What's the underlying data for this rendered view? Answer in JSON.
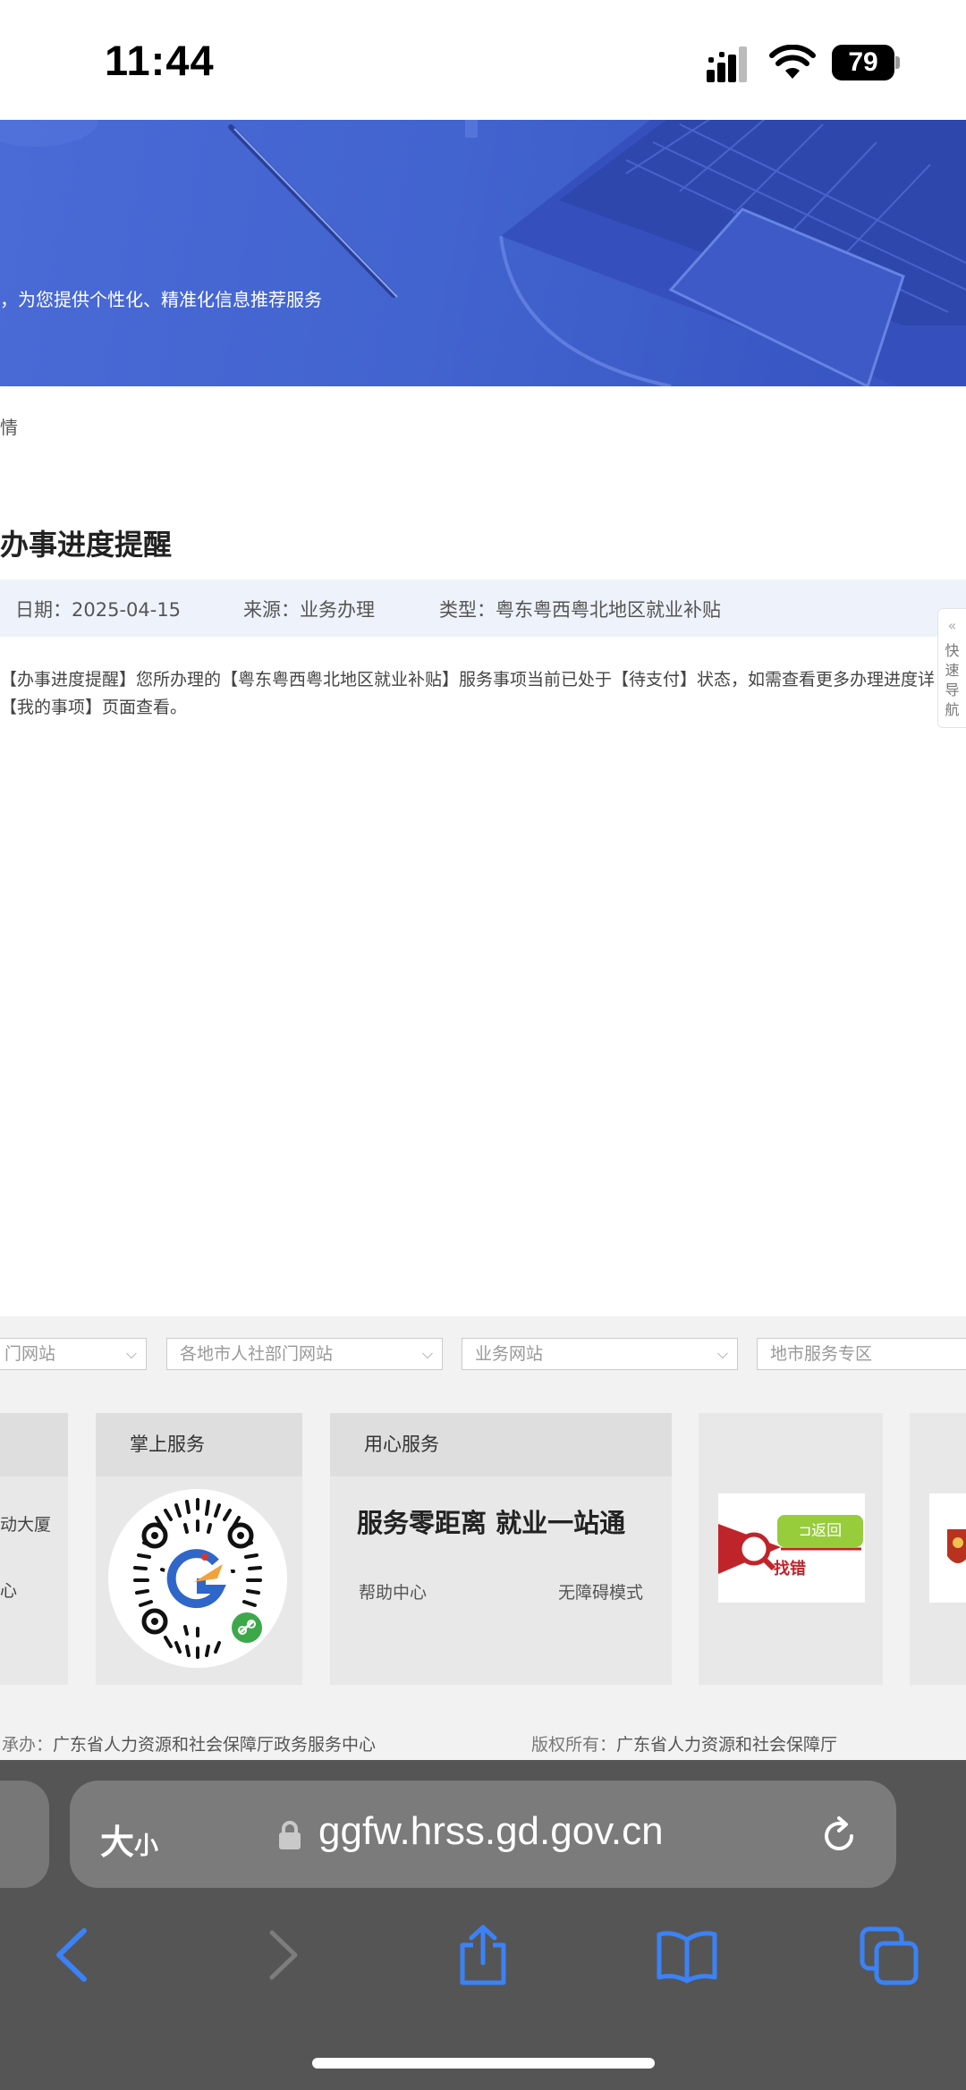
{
  "status": {
    "time": "11:44",
    "battery": "79"
  },
  "banner": {
    "text": "，为您提供个性化、精准化信息推荐服务"
  },
  "note": {
    "text": "情"
  },
  "article": {
    "title": "办事进度提醒",
    "date": "日期：2025-04-15",
    "source": "来源：业务办理",
    "type": "类型：粤东粤西粤北地区就业补贴",
    "body_line1": "【办事进度提醒】您所办理的【粤东粤西粤北地区就业补贴】服务事项当前已处于【待支付】状态，如需查看更多办理进度详",
    "body_line2": "【我的事项】页面查看。"
  },
  "quick_nav": {
    "chevron": "«",
    "c1": "快",
    "c2": "速",
    "c3": "导",
    "c4": "航"
  },
  "footer": {
    "selects": [
      "门网站",
      "各地市人社部门网站",
      "业务网站",
      "地市服务专区"
    ],
    "card0": {
      "line1": "动大厦",
      "line2": "心"
    },
    "mobile": {
      "title": "掌上服务"
    },
    "care": {
      "title": "用心服务",
      "slogan": "服务零距离 就业一站通",
      "help": "帮助中心",
      "accessible": "无障碍模式"
    },
    "findbug": {
      "text": "找错",
      "back": "⊐返回"
    },
    "organizer_label": "承办：",
    "organizer": "广东省人力资源和社会保障厅政务服务中心",
    "copyright_label": "版权所有：",
    "copyright": "广东省人力资源和社会保障厅"
  },
  "browser": {
    "aa_big": "大",
    "aa_small": "小",
    "url": "ggfw.hrss.gd.gov.cn"
  }
}
